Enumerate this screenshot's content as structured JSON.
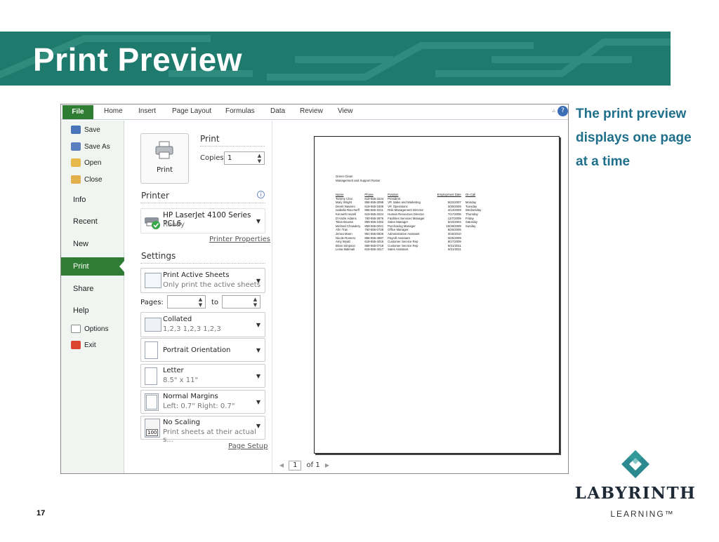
{
  "slide": {
    "title": "Print Preview",
    "caption": "The print preview displays one page at a time",
    "number": "17",
    "logo": {
      "word": "LABYRINTH",
      "sub": "LEARNING™"
    },
    "colors": {
      "banner": "#1f7a6e",
      "caption": "#1f6f8b",
      "accent": "#2f7d34"
    }
  },
  "ribbon": {
    "tabs": [
      "File",
      "Home",
      "Insert",
      "Page Layout",
      "Formulas",
      "Data",
      "Review",
      "View"
    ]
  },
  "backstage_nav": {
    "small_items": [
      {
        "label": "Save",
        "icon": "save-icon"
      },
      {
        "label": "Save As",
        "icon": "save-as-icon"
      },
      {
        "label": "Open",
        "icon": "open-folder-icon"
      },
      {
        "label": "Close",
        "icon": "close-folder-icon"
      }
    ],
    "big_items": [
      "Info",
      "Recent",
      "New",
      "Print",
      "Share",
      "Help"
    ],
    "selected": "Print",
    "bottom_items": [
      {
        "label": "Options",
        "icon": "options-icon"
      },
      {
        "label": "Exit",
        "icon": "exit-icon"
      }
    ]
  },
  "print_panel": {
    "heading": "Print",
    "button_label": "Print",
    "copies_label": "Copies:",
    "copies_value": "1",
    "printer_heading": "Printer",
    "printer_name": "HP LaserJet 4100 Series PCL6",
    "printer_status": "Ready",
    "printer_properties_link": "Printer Properties",
    "settings_heading": "Settings",
    "sheets": {
      "main": "Print Active Sheets",
      "sub": "Only print the active sheets"
    },
    "pages_label": "Pages:",
    "to_label": "to",
    "collate": {
      "main": "Collated",
      "sub": "1,2,3   1,2,3   1,2,3"
    },
    "orientation": {
      "main": "Portrait Orientation"
    },
    "paper": {
      "main": "Letter",
      "sub": "8.5\" x 11\""
    },
    "margins": {
      "main": "Normal Margins",
      "sub": "Left: 0.7\"   Right: 0.7\""
    },
    "scaling": {
      "main": "No Scaling",
      "sub": "Print sheets at their actual s...",
      "badge": "100"
    },
    "page_setup_link": "Page Setup"
  },
  "preview": {
    "title_line1": "Green Clean",
    "title_line2": "Management and Support Roster",
    "columns": [
      "Name",
      "Phone",
      "Position",
      "Employment Date",
      "On Call"
    ],
    "rows": [
      [
        "Tommy Choi",
        "619-555-3224",
        "President",
        "",
        ""
      ],
      [
        "Mary Wright",
        "858-555-3098",
        "VP, Sales and Marketing",
        "5/22/2007",
        "Monday"
      ],
      [
        "Derek Navarro",
        "619-555-3309",
        "VP, Operations",
        "3/30/2009",
        "Tuesday"
      ],
      [
        "Isabella Riso-Neff",
        "858-555-3211",
        "Risk Management Director",
        "4/13/2009",
        "Wednesday"
      ],
      [
        "Kenneth Hazell",
        "619-555-3224",
        "Human Resources Director",
        "7/17/2006",
        "Thursday"
      ],
      [
        "D'Andre Adams",
        "760-555-3876",
        "Facilities Services Manager",
        "12/7/2009",
        "Friday"
      ],
      [
        "Talos Bouras",
        "858-555-1002",
        "Sales Manager",
        "5/10/2004",
        "Saturday"
      ],
      [
        "Michael Chowdery",
        "858-555-0021",
        "Purchasing Manager",
        "10/28/2009",
        "Sunday"
      ],
      [
        "Ahn Tran",
        "760-555-0728",
        "Office Manager",
        "6/26/2006",
        ""
      ],
      [
        "Jenna Mann",
        "951-555-0826",
        "Administrative Assistant",
        "3/15/2010",
        ""
      ],
      [
        "Nicole Romero",
        "858-555-4987",
        "Payroll Assistant",
        "3/25/2009",
        ""
      ],
      [
        "Amy Wyatt",
        "619-555-4016",
        "Customer Service Rep",
        "8/17/2009",
        ""
      ],
      [
        "Brian Simpson",
        "858-555-0718",
        "Customer Service Rep",
        "9/21/2011",
        ""
      ],
      [
        "Leisa Malimali",
        "619-555-4017",
        "Sales Assistant",
        "9/21/2011",
        ""
      ]
    ],
    "page_current": "1",
    "page_total": "of 1"
  }
}
